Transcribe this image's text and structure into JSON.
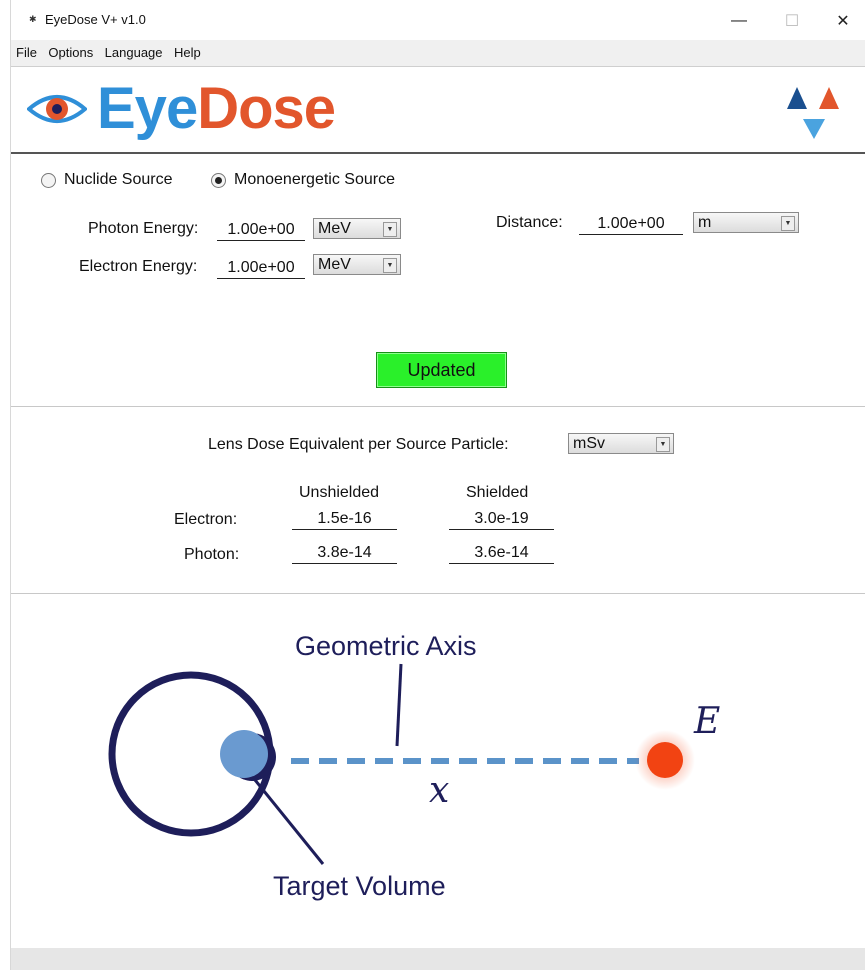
{
  "window": {
    "title": "EyeDose  V+ v1.0",
    "minimize_glyph": "—",
    "maximize_glyph": "☐",
    "close_glyph": "✕"
  },
  "menu": [
    "File",
    "Options",
    "Language",
    "Help"
  ],
  "logo": {
    "part1": "Eye",
    "part2": "Dose"
  },
  "source": {
    "nuclide_label": "Nuclide Source",
    "mono_label": "Monoenergetic Source",
    "selected": "Monoenergetic Source"
  },
  "inputs": {
    "photon_energy_label": "Photon Energy:",
    "photon_energy_value": "1.00e+00",
    "photon_energy_unit": "MeV",
    "electron_energy_label": "Electron Energy:",
    "electron_energy_value": "1.00e+00",
    "electron_energy_unit": "MeV",
    "distance_label": "Distance:",
    "distance_value": "1.00e+00",
    "distance_unit": "m"
  },
  "update_button": "Updated",
  "results": {
    "header_label": "Lens Dose Equivalent per Source Particle:",
    "unit": "mSv",
    "col_unshielded": "Unshielded",
    "col_shielded": "Shielded",
    "rows": [
      {
        "label": "Electron:",
        "unshielded": "1.5e-16",
        "shielded": "3.0e-19"
      },
      {
        "label": "Photon:",
        "unshielded": "3.8e-14",
        "shielded": "3.6e-14"
      }
    ]
  },
  "diagram": {
    "axis_label": "Geometric Axis",
    "target_label": "Target Volume",
    "distance_symbol": "x",
    "energy_symbol": "E"
  },
  "colors": {
    "logo_blue": "#2f8fd8",
    "logo_orange": "#e2562c",
    "update_green": "#2af02a",
    "diagram_navy": "#1e1e5a",
    "axis_blue": "#5b93c9",
    "source_red": "#f24312"
  }
}
